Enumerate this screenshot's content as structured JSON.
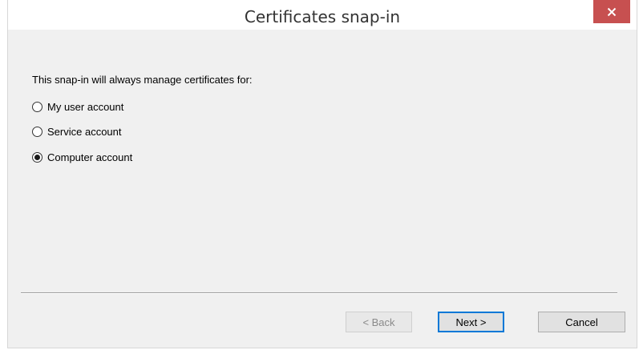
{
  "window": {
    "title": "Certificates snap-in",
    "close_glyph": "✕"
  },
  "content": {
    "prompt": "This snap-in will always manage certificates for:",
    "options": [
      {
        "label": "My user account",
        "selected": false
      },
      {
        "label": "Service account",
        "selected": false
      },
      {
        "label": "Computer account",
        "selected": true
      }
    ]
  },
  "buttons": {
    "back": "< Back",
    "next": "Next >",
    "cancel": "Cancel"
  },
  "colors": {
    "close_button": "#c75050",
    "default_button_border": "#0078d7"
  }
}
